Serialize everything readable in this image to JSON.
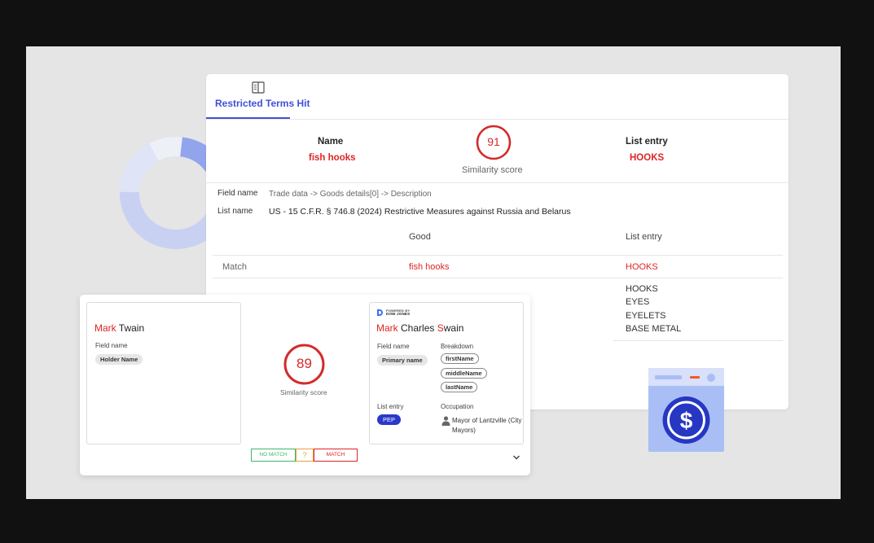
{
  "colors": {
    "accent": "#3f51d6",
    "red": "#e02424",
    "match_green": "#3db56a",
    "maybe_orange": "#e6a23c",
    "pep_blue": "#2b39c9"
  },
  "tab": {
    "icon": "book-icon",
    "label": "Restricted Terms Hit"
  },
  "summary": {
    "name_header": "Name",
    "name_value": "fish hooks",
    "score": "91",
    "score_label": "Similarity score",
    "list_entry_header": "List entry",
    "list_entry_value": "HOOKS"
  },
  "details": {
    "field_name_key": "Field name",
    "field_name_value": "Trade data -> Goods details[0] -> Description",
    "list_name_key": "List name",
    "list_name_value": "US - 15 C.F.R. § 746.8 (2024) Restrictive Measures against Russia and Belarus"
  },
  "table": {
    "col_good": "Good",
    "col_list_entry": "List entry",
    "match_label": "Match",
    "match_good": "fish hooks",
    "match_entry": "HOOKS",
    "entries": [
      "HOOKS",
      "EYES",
      "EYELETS",
      "BASE METAL"
    ]
  },
  "comparison": {
    "left": {
      "first": "Mark",
      "last": "Twain",
      "field_name_key": "Field name",
      "field_chip": "Holder Name"
    },
    "score": "89",
    "score_label": "Similarity score",
    "right": {
      "logo_line1": "POWERED BY",
      "logo_line2": "DOW JONES",
      "first": "Mark",
      "middle": "Charles",
      "last_hl": "S",
      "last_rest": "wain",
      "field_name_key": "Field name",
      "field_chip": "Primary name",
      "breakdown_key": "Breakdown",
      "breakdown": [
        "firstName",
        "middleName",
        "lastName"
      ],
      "list_entry_key": "List entry",
      "list_entry_chip": "PEP",
      "occupation_key": "Occupation",
      "occupation_value": "Mayor of Lantzville (City Mayors)"
    },
    "buttons": {
      "no_match": "NO MATCH",
      "unsure": "?",
      "match": "MATCH"
    }
  }
}
